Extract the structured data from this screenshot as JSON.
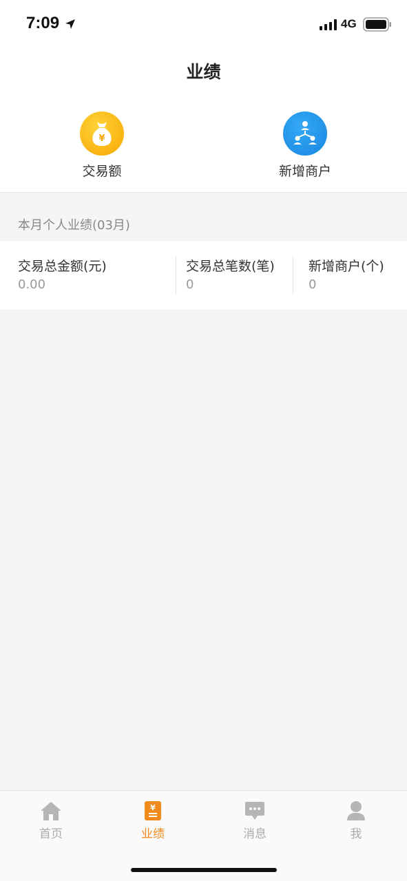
{
  "status_bar": {
    "time": "7:09",
    "network": "4G",
    "icons": [
      "location-arrow-icon",
      "signal-icon",
      "battery-icon"
    ]
  },
  "header": {
    "title": "业绩"
  },
  "quick_actions": [
    {
      "label": "交易额",
      "icon": "money-bag-icon",
      "color": "#f6a700"
    },
    {
      "label": "新增商户",
      "icon": "network-people-icon",
      "color": "#1787e0"
    }
  ],
  "section": {
    "title": "本月个人业绩(03月)"
  },
  "stats": [
    {
      "label": "交易总金额(元)",
      "value": "0.00"
    },
    {
      "label": "交易总笔数(笔)",
      "value": "0"
    },
    {
      "label": "新增商户(个)",
      "value": "0"
    }
  ],
  "tabs": [
    {
      "label": "首页",
      "icon": "home-icon",
      "active": false
    },
    {
      "label": "业绩",
      "icon": "performance-icon",
      "active": true
    },
    {
      "label": "消息",
      "icon": "message-icon",
      "active": false
    },
    {
      "label": "我",
      "icon": "user-icon",
      "active": false
    }
  ],
  "colors": {
    "accent": "#f08a1c",
    "inactive": "#aaaaaa"
  }
}
